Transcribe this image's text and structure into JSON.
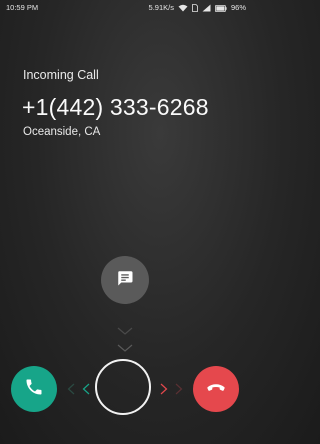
{
  "status_bar": {
    "time": "10:59 PM",
    "network_speed": "5.91K/s",
    "battery": "96%",
    "icons": [
      "wifi-icon",
      "sim-icon",
      "signal-icon",
      "battery-icon"
    ]
  },
  "call": {
    "label": "Incoming Call",
    "number": "+1(442) 333-6268",
    "location": "Oceanside, CA"
  },
  "actions": {
    "message_icon": "message-icon",
    "answer_icon": "phone-icon",
    "decline_icon": "phone-hangup-icon"
  },
  "colors": {
    "answer": "#17a589",
    "decline": "#e5484d",
    "message_button": "#5a5a5a"
  }
}
